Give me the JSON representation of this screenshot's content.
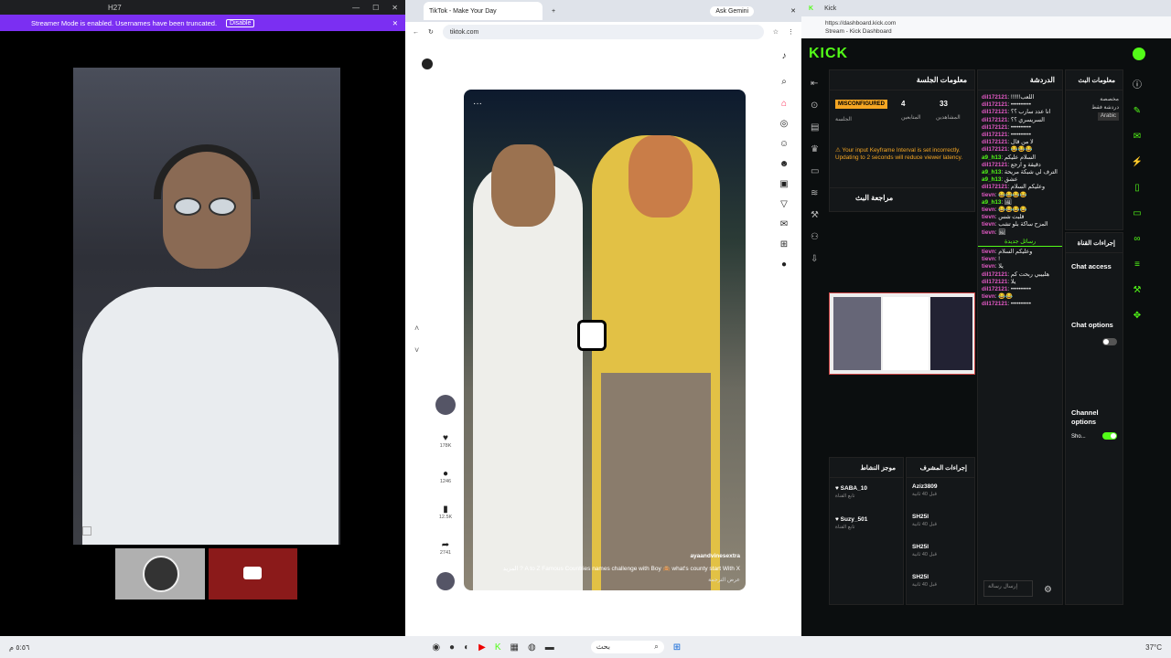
{
  "discord": {
    "title": "H27",
    "banner_text": "Streamer Mode is enabled. Usernames have been truncated.",
    "disable_label": "Disable"
  },
  "browser": {
    "tab_title": "TikTok - Make Your Day",
    "gemini_label": "Ask Gemini",
    "url": "tiktok.com",
    "video": {
      "handle": "ayaandvinesextra",
      "caption": "? A to Z Famous Countries names challenge with Boy 🙈 what's county start With X",
      "more": "المزيد",
      "translation": "عرض الترجمة"
    },
    "actions": {
      "likes": "178K",
      "comments": "1246",
      "saves": "12.5K",
      "shares": "2741"
    }
  },
  "kick": {
    "chrome_url": "https://dashboard.kick.com",
    "chrome_sub": "Stream - Kick Dashboard",
    "logo": "KICK",
    "session": {
      "title": "معلومات الجلسة",
      "status": "MISCONFIGURED",
      "status_sub": "الجلسة",
      "followers_value": "4",
      "followers_label": "المتابعين",
      "viewers_value": "33",
      "viewers_label": "المشاهدين",
      "warning": "Your input Keyframe Interval is set incorrectly. Updating to 2 seconds will reduce viewer latency."
    },
    "review_title": "مراجعة البث",
    "chat": {
      "title": "الدردشة",
      "lines": [
        {
          "user": "dil172121",
          "text": "!!!!!!اللعب"
        },
        {
          "user": "dil172121",
          "text": "••••••••••"
        },
        {
          "user": "dil172121",
          "text": "انا عدد سارب ؟؟"
        },
        {
          "user": "dil172121",
          "text": "السريسري ؟؟"
        },
        {
          "user": "dil172121",
          "text": "••••••••••"
        },
        {
          "user": "dil172121",
          "text": "••••••••••"
        },
        {
          "user": "dil172121",
          "text": "لا من قال"
        },
        {
          "user": "dil172121",
          "text": "😂😂😂"
        },
        {
          "user": "a9_h13",
          "text": "السلام عليكم",
          "green": true
        },
        {
          "user": "dil172121",
          "text": "دقيقة و ارجع"
        },
        {
          "user": "a9_h13",
          "text": "الترف لي شبكة مريحة",
          "green": true
        },
        {
          "user": "a9_h13",
          "text": "عشق",
          "green": true
        },
        {
          "user": "dil172121",
          "text": "وعليكم السلام"
        },
        {
          "user": "tievn",
          "text": "😂😂😂😂"
        },
        {
          "user": "a9_h13",
          "text": "🖼",
          "green": true
        },
        {
          "user": "tievn",
          "text": "😂😂😂😂"
        },
        {
          "user": "tievn",
          "text": "قلبت شس"
        },
        {
          "user": "tievn",
          "text": "المزح ساكة بلو تشب"
        },
        {
          "user": "tievn",
          "text": "🖼"
        }
      ],
      "new_messages": "رسائل جديدة",
      "lines2": [
        {
          "user": "tievn",
          "text": "وعليكم السلام"
        },
        {
          "user": "tievn",
          "text": "!"
        },
        {
          "user": "tievn",
          "text": "يلا"
        },
        {
          "user": "dil172121",
          "text": "هلبيبي ربحت كم"
        },
        {
          "user": "dil172121",
          "text": "يلا"
        },
        {
          "user": "dil172121",
          "text": "••••••••••"
        },
        {
          "user": "tievn",
          "text": "😂😂"
        },
        {
          "user": "dil172121",
          "text": "••••••••••"
        }
      ],
      "send_placeholder": "إرسال رسالة"
    },
    "info": {
      "title": "معلومات البث",
      "line1": "مخصصة",
      "line2": "دردشة فقط",
      "lang": "Arabic"
    },
    "actions": {
      "title": "إجراءات القناة",
      "chat_access": "Chat access",
      "chat_options": "Chat options",
      "channel_options": "Channel options",
      "show_label": "Sho..."
    },
    "mod_actions": {
      "title": "إجراءات المشرف",
      "items": [
        {
          "user": "Aziz3809",
          "detail": "قبل 40 ثانية"
        },
        {
          "user": "SH25I",
          "detail": "قبل 40 ثانية"
        },
        {
          "user": "SH25I",
          "detail": "قبل 40 ثانية"
        },
        {
          "user": "SH25I",
          "detail": "قبل 40 ثانية"
        }
      ]
    },
    "users": {
      "title": "موجز النشاط",
      "items": [
        {
          "user": "SABA_10",
          "detail": "تابع القناة"
        },
        {
          "user": "Suzy_501",
          "detail": "تابع القناة"
        }
      ]
    }
  },
  "taskbar": {
    "search": "بحث",
    "temp": "37°C",
    "time": "٥:٥٦ م"
  }
}
